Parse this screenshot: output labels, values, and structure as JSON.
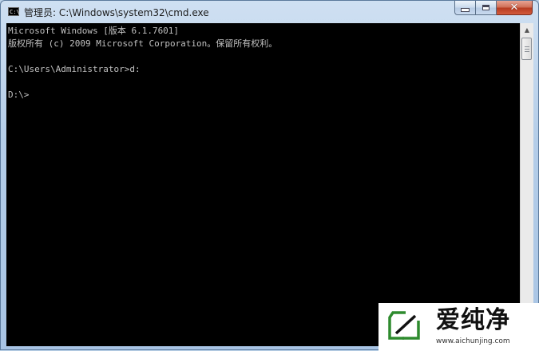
{
  "window": {
    "title": "管理员: C:\\Windows\\system32\\cmd.exe",
    "app_icon_text": "C:\\",
    "controls": {
      "minimize": "minimize",
      "maximize": "maximize",
      "close": "✕"
    }
  },
  "console": {
    "lines": [
      "Microsoft Windows [版本 6.1.7601]",
      "版权所有 (c) 2009 Microsoft Corporation。保留所有权利。",
      "",
      "C:\\Users\\Administrator>d:",
      "",
      "D:\\>"
    ]
  },
  "watermark": {
    "name": "爱纯净",
    "url": "www.aichunjing.com"
  },
  "colors": {
    "console_bg": "#000000",
    "console_text": "#c0c0c0",
    "close_button": "#c94a2e",
    "watermark_green": "#2e8b2e"
  },
  "icons": {
    "app": "cmd-icon",
    "minimize": "minimize-icon",
    "maximize": "maximize-icon",
    "close": "close-icon",
    "scroll_up": "arrow-up-icon",
    "scroll_down": "arrow-down-icon"
  }
}
